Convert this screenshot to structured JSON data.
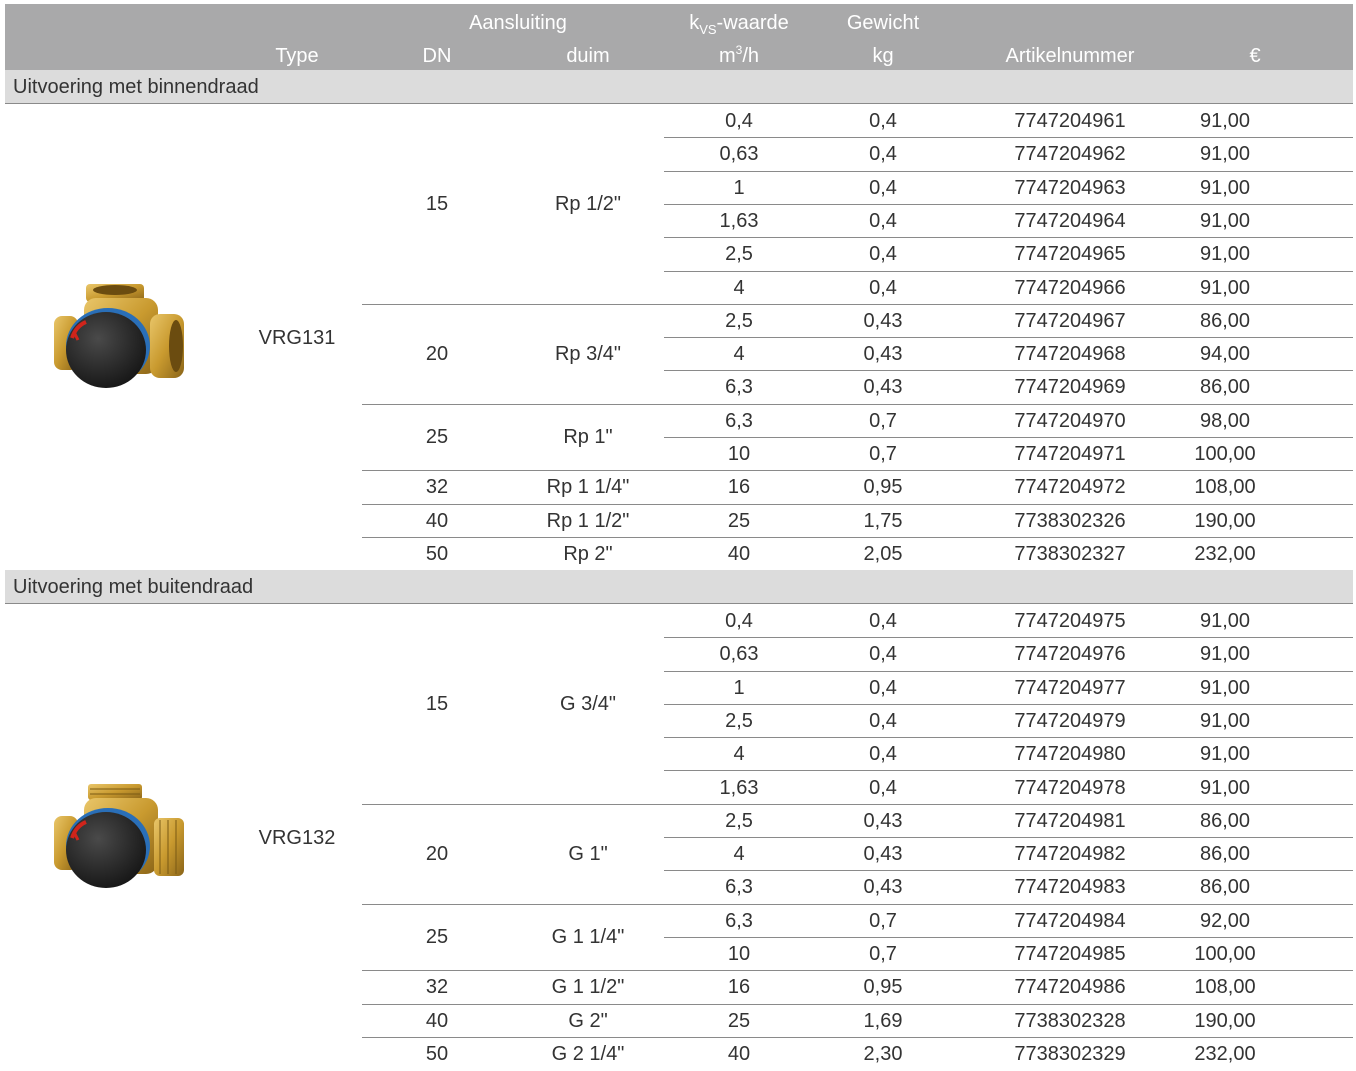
{
  "header": {
    "aansluiting": "Aansluiting",
    "type": "Type",
    "dn": "DN",
    "duim": "duim",
    "kvs_k": "k",
    "kvs_sub": "VS",
    "kvs_rest": "-waarde",
    "kvs_unit_m": "m",
    "kvs_unit_sup": "3",
    "kvs_unit_rest": "/h",
    "gewicht": "Gewicht",
    "kg": "kg",
    "artikelnummer": "Artikelnummer",
    "euro": "€"
  },
  "sections": [
    {
      "title": "Uitvoering met binnendraad",
      "type": "VRG131",
      "image_icon": "valve-internal-thread-icon",
      "groups": [
        {
          "dn": "15",
          "duim": "Rp 1/2\"",
          "rows": [
            {
              "kvs": "0,4",
              "kg": "0,4",
              "art": "7747204961",
              "price": "91,00"
            },
            {
              "kvs": "0,63",
              "kg": "0,4",
              "art": "7747204962",
              "price": "91,00"
            },
            {
              "kvs": "1",
              "kg": "0,4",
              "art": "7747204963",
              "price": "91,00"
            },
            {
              "kvs": "1,63",
              "kg": "0,4",
              "art": "7747204964",
              "price": "91,00"
            },
            {
              "kvs": "2,5",
              "kg": "0,4",
              "art": "7747204965",
              "price": "91,00"
            },
            {
              "kvs": "4",
              "kg": "0,4",
              "art": "7747204966",
              "price": "91,00"
            }
          ]
        },
        {
          "dn": "20",
          "duim": "Rp 3/4\"",
          "rows": [
            {
              "kvs": "2,5",
              "kg": "0,43",
              "art": "7747204967",
              "price": "86,00"
            },
            {
              "kvs": "4",
              "kg": "0,43",
              "art": "7747204968",
              "price": "94,00"
            },
            {
              "kvs": "6,3",
              "kg": "0,43",
              "art": "7747204969",
              "price": "86,00"
            }
          ]
        },
        {
          "dn": "25",
          "duim": "Rp 1\"",
          "rows": [
            {
              "kvs": "6,3",
              "kg": "0,7",
              "art": "7747204970",
              "price": "98,00"
            },
            {
              "kvs": "10",
              "kg": "0,7",
              "art": "7747204971",
              "price": "100,00"
            }
          ]
        },
        {
          "dn": "32",
          "duim": "Rp 1 1/4\"",
          "rows": [
            {
              "kvs": "16",
              "kg": "0,95",
              "art": "7747204972",
              "price": "108,00"
            }
          ]
        },
        {
          "dn": "40",
          "duim": "Rp 1 1/2\"",
          "rows": [
            {
              "kvs": "25",
              "kg": "1,75",
              "art": "7738302326",
              "price": "190,00"
            }
          ]
        },
        {
          "dn": "50",
          "duim": "Rp 2\"",
          "rows": [
            {
              "kvs": "40",
              "kg": "2,05",
              "art": "7738302327",
              "price": "232,00"
            }
          ]
        }
      ]
    },
    {
      "title": "Uitvoering met buitendraad",
      "type": "VRG132",
      "image_icon": "valve-external-thread-icon",
      "groups": [
        {
          "dn": "15",
          "duim": "G 3/4\"",
          "rows": [
            {
              "kvs": "0,4",
              "kg": "0,4",
              "art": "7747204975",
              "price": "91,00"
            },
            {
              "kvs": "0,63",
              "kg": "0,4",
              "art": "7747204976",
              "price": "91,00"
            },
            {
              "kvs": "1",
              "kg": "0,4",
              "art": "7747204977",
              "price": "91,00"
            },
            {
              "kvs": "2,5",
              "kg": "0,4",
              "art": "7747204979",
              "price": "91,00"
            },
            {
              "kvs": "4",
              "kg": "0,4",
              "art": "7747204980",
              "price": "91,00"
            },
            {
              "kvs": "1,63",
              "kg": "0,4",
              "art": "7747204978",
              "price": "91,00"
            }
          ]
        },
        {
          "dn": "20",
          "duim": "G 1\"",
          "rows": [
            {
              "kvs": "2,5",
              "kg": "0,43",
              "art": "7747204981",
              "price": "86,00"
            },
            {
              "kvs": "4",
              "kg": "0,43",
              "art": "7747204982",
              "price": "86,00"
            },
            {
              "kvs": "6,3",
              "kg": "0,43",
              "art": "7747204983",
              "price": "86,00"
            }
          ]
        },
        {
          "dn": "25",
          "duim": "G 1 1/4\"",
          "rows": [
            {
              "kvs": "6,3",
              "kg": "0,7",
              "art": "7747204984",
              "price": "92,00"
            },
            {
              "kvs": "10",
              "kg": "0,7",
              "art": "7747204985",
              "price": "100,00"
            }
          ]
        },
        {
          "dn": "32",
          "duim": "G 1 1/2\"",
          "rows": [
            {
              "kvs": "16",
              "kg": "0,95",
              "art": "7747204986",
              "price": "108,00"
            }
          ]
        },
        {
          "dn": "40",
          "duim": "G 2\"",
          "rows": [
            {
              "kvs": "25",
              "kg": "1,69",
              "art": "7738302328",
              "price": "190,00"
            }
          ]
        },
        {
          "dn": "50",
          "duim": "G 2 1/4\"",
          "rows": [
            {
              "kvs": "40",
              "kg": "2,30",
              "art": "7738302329",
              "price": "232,00"
            }
          ]
        }
      ]
    }
  ]
}
